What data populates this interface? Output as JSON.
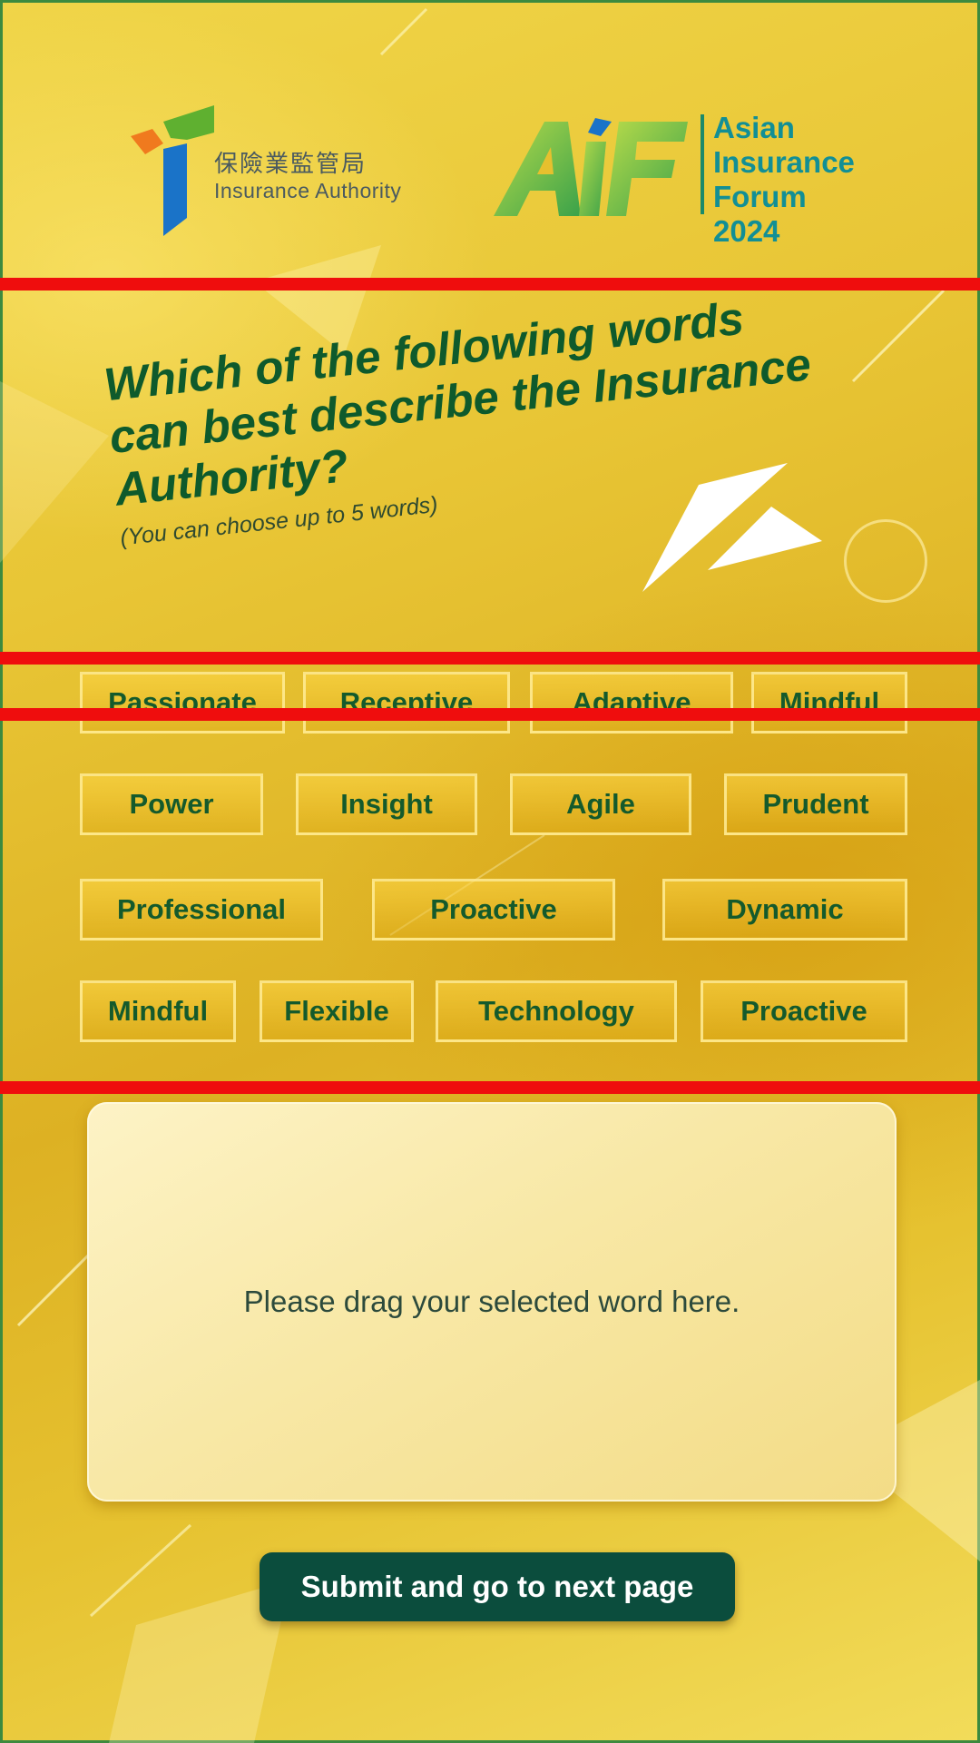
{
  "header": {
    "ia_logo": {
      "name_zh": "保險業監管局",
      "name_en": "Insurance Authority",
      "icon": "insurance-authority-logo-mark",
      "colors": [
        "#f07a1e",
        "#5fb030",
        "#1a73c8"
      ]
    },
    "aif_logo": {
      "wordmark": "AIF",
      "line1": "Asian",
      "line2": "Insurance",
      "line3": "Forum 2024",
      "colors": [
        "#8cc63f",
        "#1a9a9a"
      ]
    }
  },
  "question": {
    "title": "Which of the following words can best describe the Insurance Authority?",
    "hint": "(You can choose up to 5 words)"
  },
  "word_options": {
    "row1": [
      "Passionate",
      "Receptive",
      "Adaptive",
      "Mindful"
    ],
    "row2": [
      "Power",
      "Insight",
      "Agile",
      "Prudent"
    ],
    "row3": [
      "Professional",
      "Proactive",
      "Dynamic"
    ],
    "row4": [
      "Mindful",
      "Flexible",
      "Technology",
      "Proactive"
    ]
  },
  "drop_zone": {
    "placeholder": "Please drag your selected word here."
  },
  "submit": {
    "label": "Submit and go to next page"
  },
  "colors": {
    "background": "#e6c02e",
    "question_text": "#0e5a2c",
    "chip_text": "#145a2c",
    "button": "#0b4d3d",
    "annotation_bars": "#ef0d0d"
  }
}
